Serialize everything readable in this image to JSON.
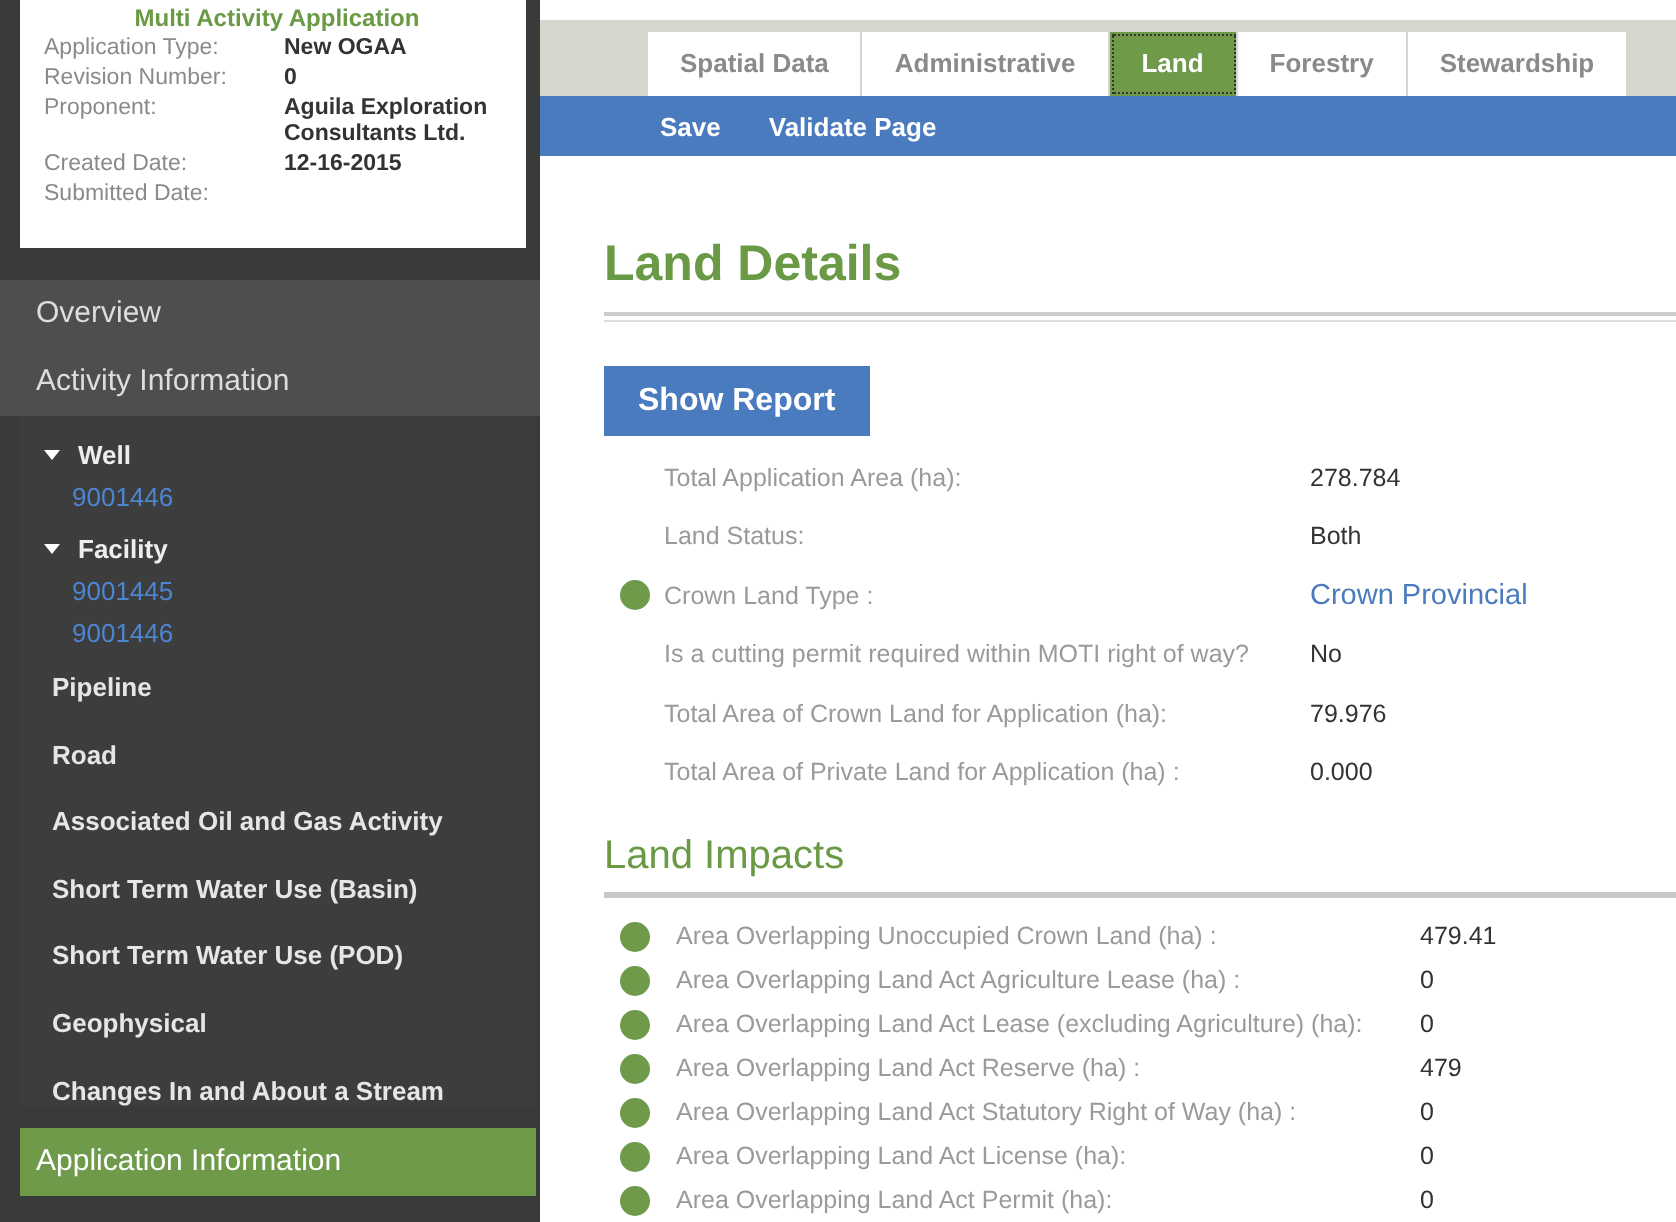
{
  "application_card": {
    "title": "Multi Activity Application",
    "fields": [
      {
        "label": "Application Type:",
        "value": "New OGAA"
      },
      {
        "label": "Revision Number:",
        "value": "0"
      },
      {
        "label": "Proponent:",
        "value": "Aguila Exploration Consultants Ltd."
      },
      {
        "label": "Created Date:",
        "value": "12-16-2015"
      },
      {
        "label": "Submitted Date:"
      }
    ]
  },
  "sidebar": {
    "top_items": [
      {
        "label": "Overview",
        "selected": false
      },
      {
        "label": "Activity Information",
        "selected": false
      }
    ],
    "activity_tree": [
      {
        "label": "Well",
        "expanded": true,
        "children": [
          {
            "label": "9001446"
          }
        ]
      },
      {
        "label": "Facility",
        "expanded": true,
        "children": [
          {
            "label": "9001445"
          },
          {
            "label": "9001446"
          }
        ]
      },
      {
        "label": "Pipeline"
      },
      {
        "label": "Road"
      },
      {
        "label": "Associated Oil and Gas Activity"
      },
      {
        "label": "Short Term Water Use (Basin)"
      },
      {
        "label": "Short Term Water Use (POD)"
      },
      {
        "label": "Geophysical"
      },
      {
        "label": "Changes In and About a Stream"
      }
    ],
    "bottom_items": [
      {
        "label": "Application Information",
        "selected": true
      }
    ]
  },
  "tabs": [
    {
      "label": "Spatial Data",
      "selected": false
    },
    {
      "label": "Administrative",
      "selected": false
    },
    {
      "label": "Land",
      "selected": true
    },
    {
      "label": "Forestry",
      "selected": false
    },
    {
      "label": "Stewardship",
      "selected": false
    }
  ],
  "toolbar": [
    "Save",
    "Validate Page"
  ],
  "land_details": {
    "title": "Land Details",
    "button": "Show Report",
    "rows": [
      {
        "label": "Total Application Area (ha):",
        "value": "278.784",
        "flagged": false,
        "kind": "text"
      },
      {
        "label": "Land Status:",
        "value": "Both",
        "flagged": false,
        "kind": "text"
      },
      {
        "label": "Crown Land Type :",
        "value": "Crown Provincial",
        "flagged": true,
        "kind": "link"
      },
      {
        "label": "Is a cutting permit required within MOTI right of way?",
        "value": "No",
        "flagged": false,
        "kind": "text"
      },
      {
        "label": "Total Area of Crown Land for Application (ha):",
        "value": "79.976",
        "flagged": false,
        "kind": "text"
      },
      {
        "label": "Total Area of Private Land for Application (ha) :",
        "value": "0.000",
        "flagged": false,
        "kind": "text"
      }
    ]
  },
  "land_impacts": {
    "title": "Land Impacts",
    "rows": [
      {
        "label": "Area Overlapping Unoccupied Crown Land (ha) :",
        "value": "479.41",
        "flagged": true
      },
      {
        "label": "Area Overlapping Land Act Agriculture Lease (ha) :",
        "value": "0",
        "flagged": true
      },
      {
        "label": "Area Overlapping Land Act Lease (excluding Agriculture) (ha):",
        "value": "0",
        "flagged": true
      },
      {
        "label": "Area Overlapping Land Act Reserve (ha) :",
        "value": "479",
        "flagged": true
      },
      {
        "label": "Area Overlapping Land Act Statutory Right of Way (ha) :",
        "value": "0",
        "flagged": true
      },
      {
        "label": "Area Overlapping Land Act License (ha):",
        "value": "0",
        "flagged": true
      },
      {
        "label": "Area Overlapping Land Act Permit (ha):",
        "value": "0",
        "flagged": true
      }
    ]
  }
}
